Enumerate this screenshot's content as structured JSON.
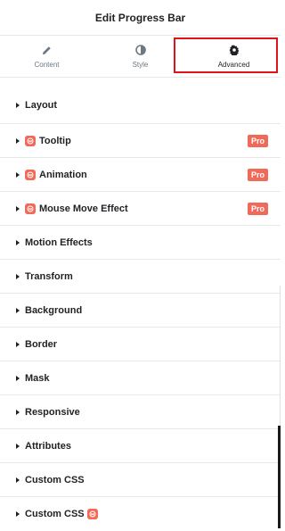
{
  "header": {
    "title": "Edit Progress Bar"
  },
  "tabs": [
    {
      "label": "Content",
      "icon": "pencil-icon"
    },
    {
      "label": "Style",
      "icon": "half-circle-icon"
    },
    {
      "label": "Advanced",
      "icon": "gear-icon"
    }
  ],
  "active_tab": "Advanced",
  "highlight_color": "#e0131b",
  "pro_color": "#f06a5a",
  "sections": [
    {
      "label": "Layout"
    },
    {
      "label": "Tooltip",
      "pro_icon": true,
      "pro_badge": "Pro"
    },
    {
      "label": "Animation",
      "pro_icon": true,
      "pro_badge": "Pro"
    },
    {
      "label": "Mouse Move Effect",
      "pro_icon": true,
      "pro_badge": "Pro"
    },
    {
      "label": "Motion Effects"
    },
    {
      "label": "Transform"
    },
    {
      "label": "Background"
    },
    {
      "label": "Border"
    },
    {
      "label": "Mask"
    },
    {
      "label": "Responsive"
    },
    {
      "label": "Attributes"
    },
    {
      "label": "Custom CSS"
    },
    {
      "label": "Custom CSS",
      "pro_icon_after": true
    }
  ]
}
